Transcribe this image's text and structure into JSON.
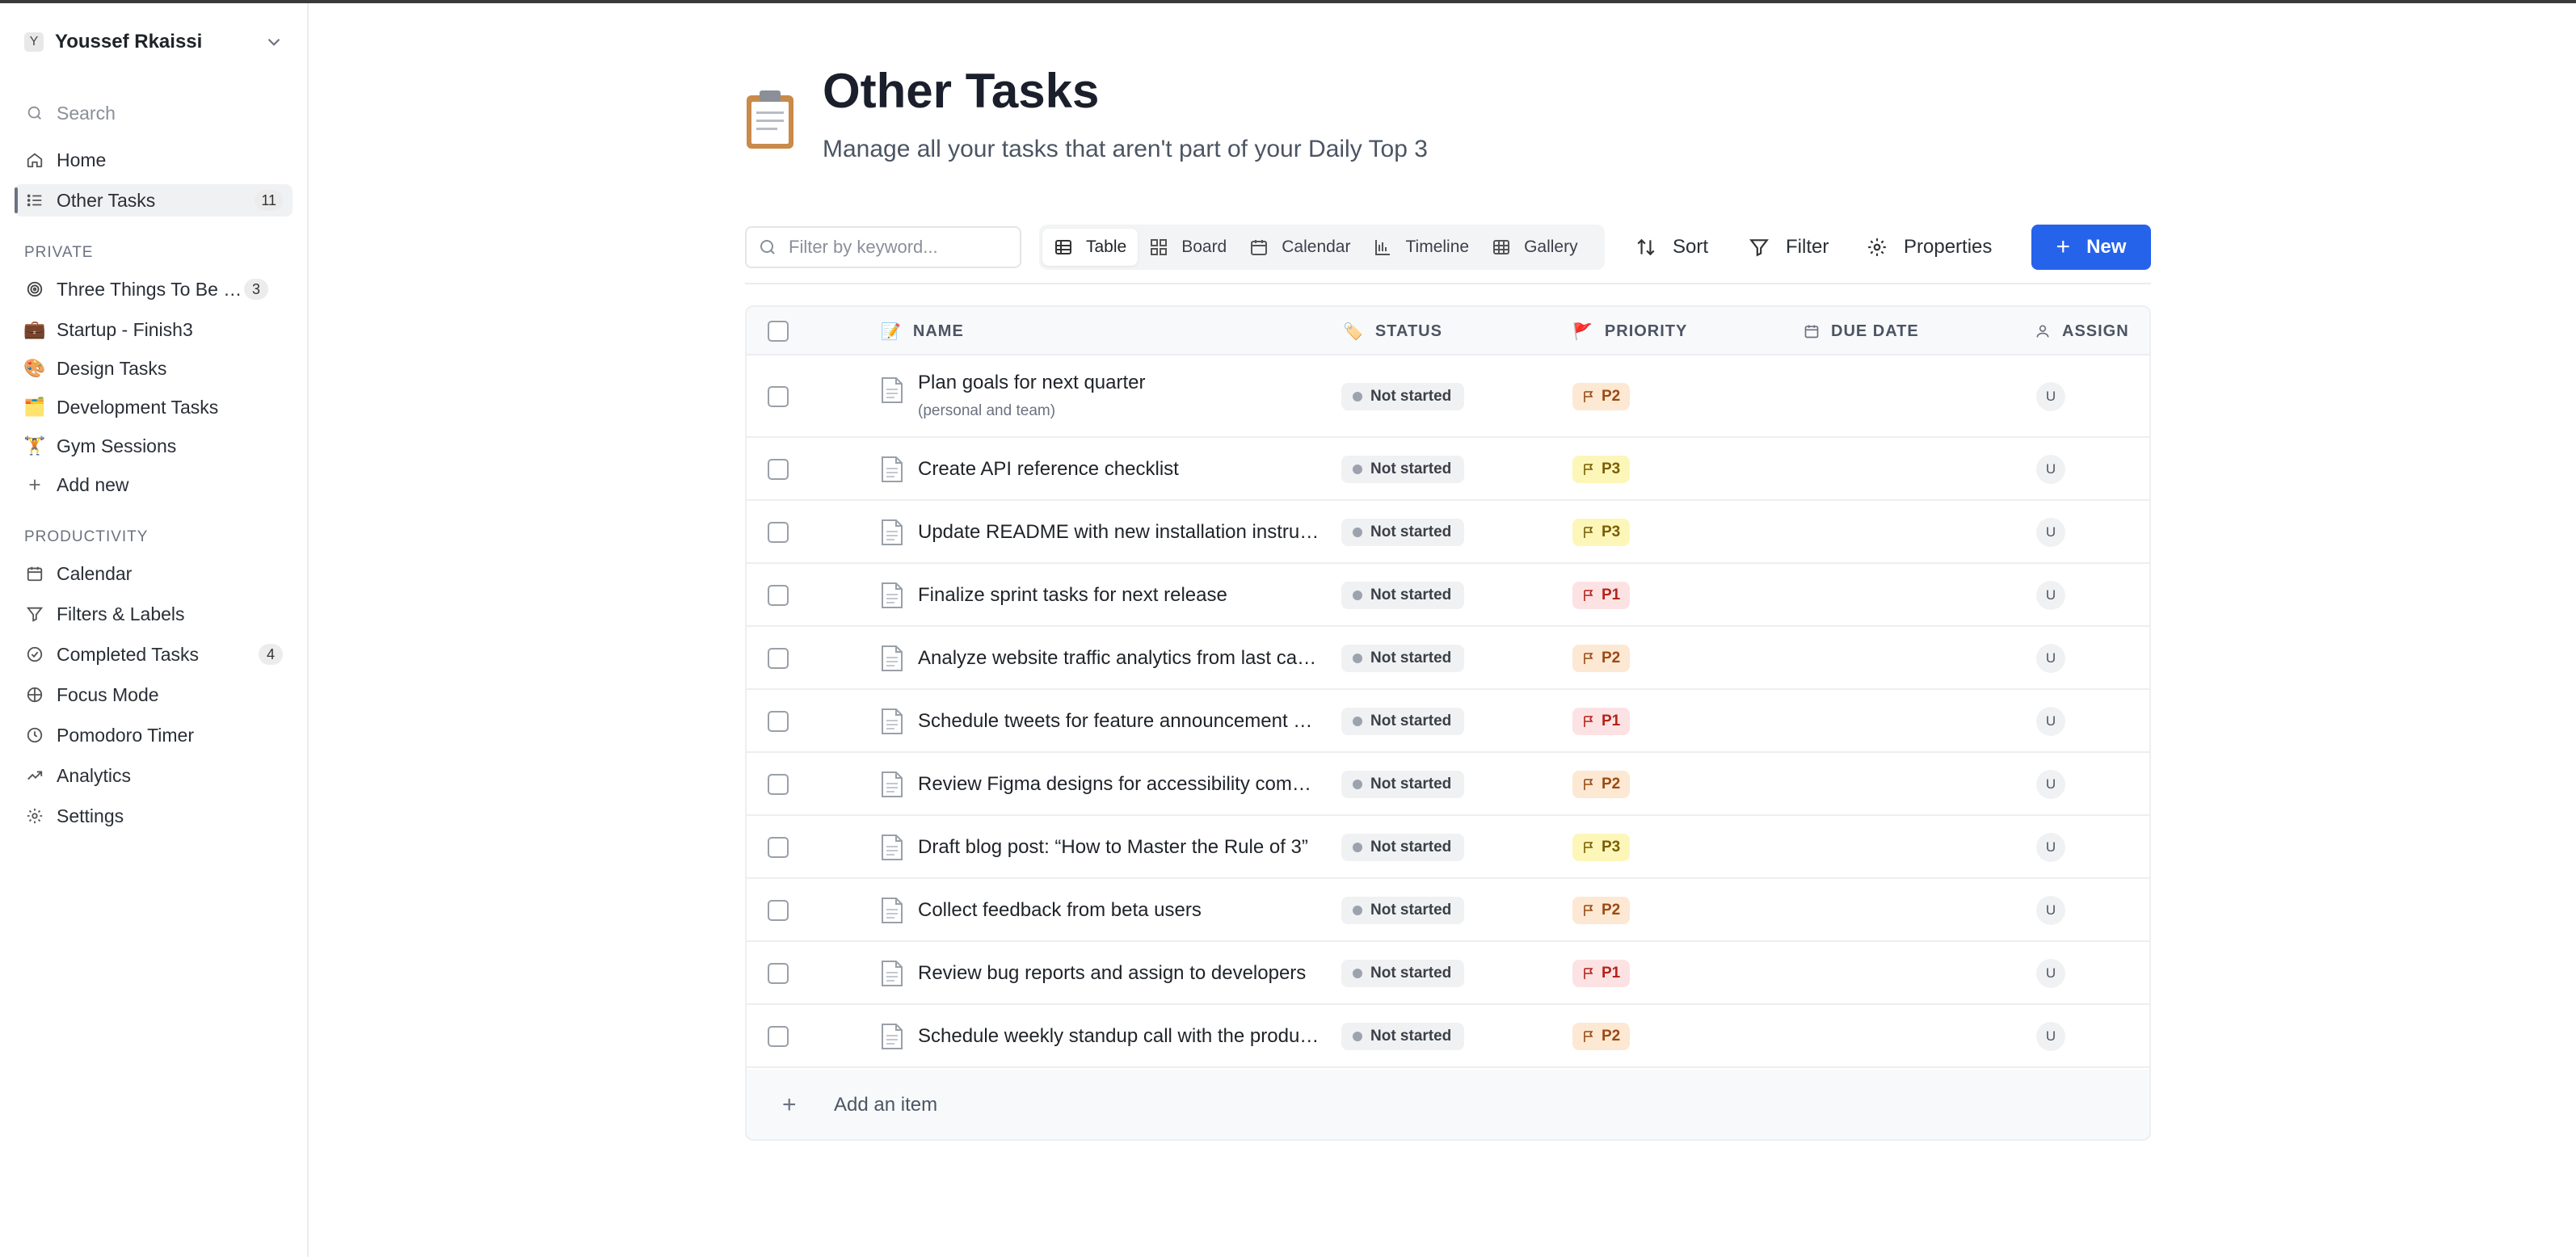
{
  "sidebar": {
    "user": {
      "initial": "Y",
      "name": "Youssef Rkaissi"
    },
    "search_label": "Search",
    "home_label": "Home",
    "other_tasks": {
      "label": "Other Tasks",
      "count": "11"
    },
    "private_heading": "PRIVATE",
    "private_items": [
      {
        "icon": "target-icon",
        "label": "Three Things To Be Done Today",
        "count": "3"
      },
      {
        "icon": "briefcase-icon",
        "label": "Startup - Finish3"
      },
      {
        "icon": "palette-icon",
        "label": "Design Tasks"
      },
      {
        "icon": "folder-icon",
        "label": "Development Tasks"
      },
      {
        "icon": "weightlifter-icon",
        "label": "Gym Sessions"
      }
    ],
    "add_new_label": "Add new",
    "productivity_heading": "PRODUCTIVITY",
    "productivity_items": [
      {
        "icon": "calendar-icon",
        "label": "Calendar"
      },
      {
        "icon": "filter-icon",
        "label": "Filters & Labels"
      },
      {
        "icon": "check-circle-icon",
        "label": "Completed Tasks",
        "count": "4"
      },
      {
        "icon": "focus-icon",
        "label": "Focus Mode"
      },
      {
        "icon": "clock-icon",
        "label": "Pomodoro Timer"
      },
      {
        "icon": "trend-icon",
        "label": "Analytics"
      },
      {
        "icon": "gear-icon",
        "label": "Settings"
      }
    ]
  },
  "page": {
    "icon": "clipboard-icon",
    "title": "Other Tasks",
    "subtitle": "Manage all your tasks that aren't part of your Daily Top 3"
  },
  "toolbar": {
    "filter_placeholder": "Filter by keyword...",
    "views": [
      "Table",
      "Board",
      "Calendar",
      "Timeline",
      "Gallery"
    ],
    "active_view": "Table",
    "sort_label": "Sort",
    "filter_label": "Filter",
    "properties_label": "Properties",
    "new_label": "New"
  },
  "table": {
    "columns": [
      "NAME",
      "STATUS",
      "PRIORITY",
      "DUE DATE",
      "ASSIGN"
    ],
    "rows": [
      {
        "name": "Plan goals for next quarter",
        "sub": "(personal and team)",
        "status": "Not started",
        "priority": "P2",
        "assignee": "U"
      },
      {
        "name": "Create API reference checklist",
        "status": "Not started",
        "priority": "P3",
        "assignee": "U"
      },
      {
        "name": "Update README with new installation instructions",
        "status": "Not started",
        "priority": "P3",
        "assignee": "U"
      },
      {
        "name": "Finalize sprint tasks for next release",
        "status": "Not started",
        "priority": "P1",
        "assignee": "U"
      },
      {
        "name": "Analyze website traffic analytics from last campaign",
        "status": "Not started",
        "priority": "P2",
        "assignee": "U"
      },
      {
        "name": "Schedule tweets for feature announcement campaign",
        "status": "Not started",
        "priority": "P1",
        "assignee": "U"
      },
      {
        "name": "Review Figma designs for accessibility compliance",
        "status": "Not started",
        "priority": "P2",
        "assignee": "U"
      },
      {
        "name": "Draft blog post: “How to Master the Rule of 3”",
        "status": "Not started",
        "priority": "P3",
        "assignee": "U"
      },
      {
        "name": "Collect feedback from beta users",
        "status": "Not started",
        "priority": "P2",
        "assignee": "U"
      },
      {
        "name": "Review bug reports and assign to developers",
        "status": "Not started",
        "priority": "P1",
        "assignee": "U"
      },
      {
        "name": "Schedule weekly standup call with the product team",
        "status": "Not started",
        "priority": "P2",
        "assignee": "U"
      }
    ],
    "add_item_label": "Add an item"
  }
}
